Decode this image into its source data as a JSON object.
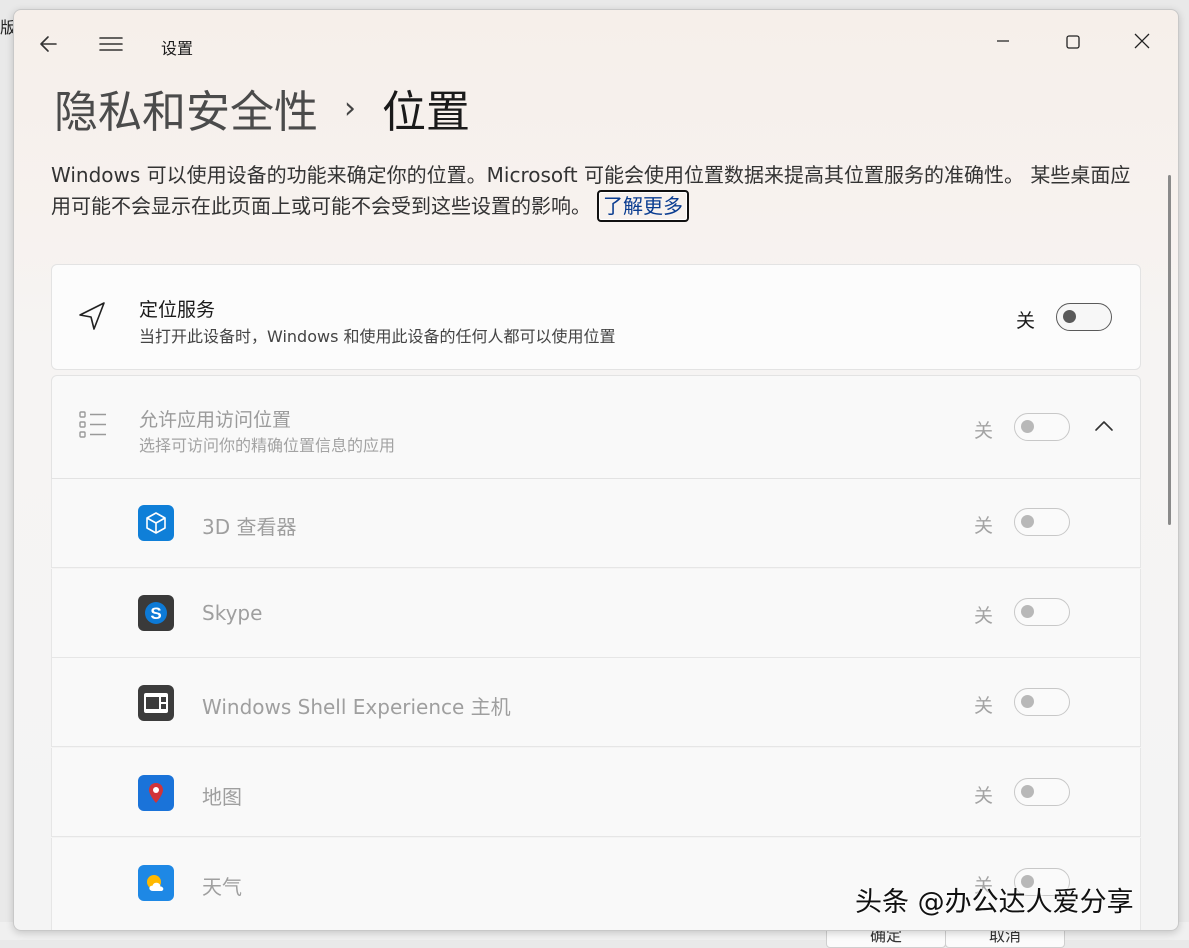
{
  "background": {
    "left_text": "版",
    "bottom_buttons": [
      "确定",
      "取消"
    ]
  },
  "titlebar": {
    "app_title": "设置",
    "back_icon": "back-arrow-icon",
    "menu_icon": "hamburger-icon"
  },
  "breadcrumb": {
    "parent": "隐私和安全性",
    "separator": "›",
    "current": "位置"
  },
  "description": {
    "text": "Windows 可以使用设备的功能来确定你的位置。Microsoft 可能会使用位置数据来提高其位置服务的准确性。 某些桌面应用可能不会显示在此页面上或可能不会受到这些设置的影响。",
    "learn_more": "了解更多"
  },
  "location_service": {
    "icon": "location-arrow-icon",
    "title": "定位服务",
    "subtitle": "当打开此设备时，Windows 和使用此设备的任何人都可以使用位置",
    "state": "关",
    "on": false
  },
  "app_access": {
    "icon": "list-icon",
    "title": "允许应用访问位置",
    "subtitle": "选择可访问你的精确位置信息的应用",
    "state": "关",
    "on": false,
    "expanded": true
  },
  "apps": [
    {
      "name": "3D 查看器",
      "icon": "3d-viewer-icon",
      "state": "关",
      "on": false
    },
    {
      "name": "Skype",
      "icon": "skype-icon",
      "state": "关",
      "on": false
    },
    {
      "name": "Windows Shell Experience 主机",
      "icon": "shell-experience-icon",
      "state": "关",
      "on": false
    },
    {
      "name": "地图",
      "icon": "maps-icon",
      "state": "关",
      "on": false
    },
    {
      "name": "天气",
      "icon": "weather-icon",
      "state": "关",
      "on": false
    }
  ],
  "watermark": "头条 @办公达人爱分享",
  "colors": {
    "accent_blue": "#0078d4",
    "maps_red": "#d13438",
    "weather_yellow": "#ffb900"
  }
}
